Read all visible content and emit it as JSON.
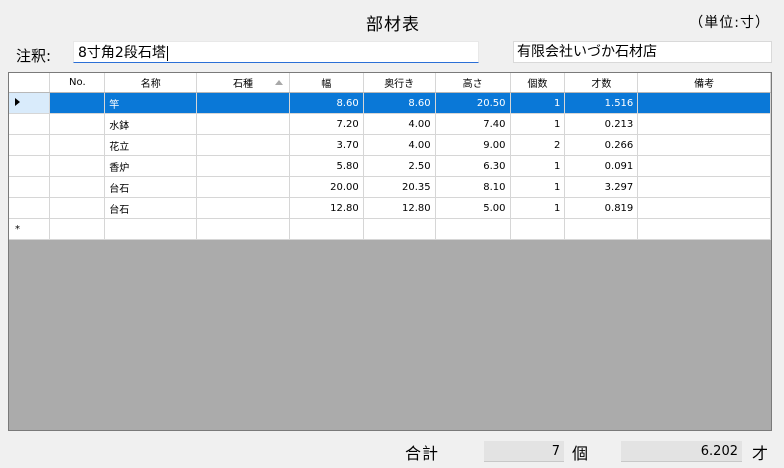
{
  "header": {
    "title": "部材表",
    "unit_label": "（単位:寸）"
  },
  "note": {
    "label": "注釈:",
    "value": "8寸角2段石塔"
  },
  "company": {
    "value": "有限会社いづか石材店"
  },
  "table": {
    "columns": [
      "No.",
      "名称",
      "石種",
      "幅",
      "奥行き",
      "高さ",
      "個数",
      "才数",
      "備考"
    ],
    "rows": [
      {
        "no": "",
        "name": "竿",
        "stone": "",
        "width": "8.60",
        "depth": "8.60",
        "height": "20.50",
        "count": "1",
        "sai": "1.516",
        "remark": ""
      },
      {
        "no": "",
        "name": "水鉢",
        "stone": "",
        "width": "7.20",
        "depth": "4.00",
        "height": "7.40",
        "count": "1",
        "sai": "0.213",
        "remark": ""
      },
      {
        "no": "",
        "name": "花立",
        "stone": "",
        "width": "3.70",
        "depth": "4.00",
        "height": "9.00",
        "count": "2",
        "sai": "0.266",
        "remark": ""
      },
      {
        "no": "",
        "name": "香炉",
        "stone": "",
        "width": "5.80",
        "depth": "2.50",
        "height": "6.30",
        "count": "1",
        "sai": "0.091",
        "remark": ""
      },
      {
        "no": "",
        "name": "台石",
        "stone": "",
        "width": "20.00",
        "depth": "20.35",
        "height": "8.10",
        "count": "1",
        "sai": "3.297",
        "remark": ""
      },
      {
        "no": "",
        "name": "台石",
        "stone": "",
        "width": "12.80",
        "depth": "12.80",
        "height": "5.00",
        "count": "1",
        "sai": "0.819",
        "remark": ""
      }
    ],
    "new_row_marker": "*",
    "selected_row": 0
  },
  "totals": {
    "label": "合計",
    "count": "7",
    "count_unit": "個",
    "sai": "6.202",
    "sai_unit": "才"
  },
  "colors": {
    "selection": "#0a78d7",
    "grid_background": "#ababab",
    "window_background": "#f0f0f0"
  }
}
